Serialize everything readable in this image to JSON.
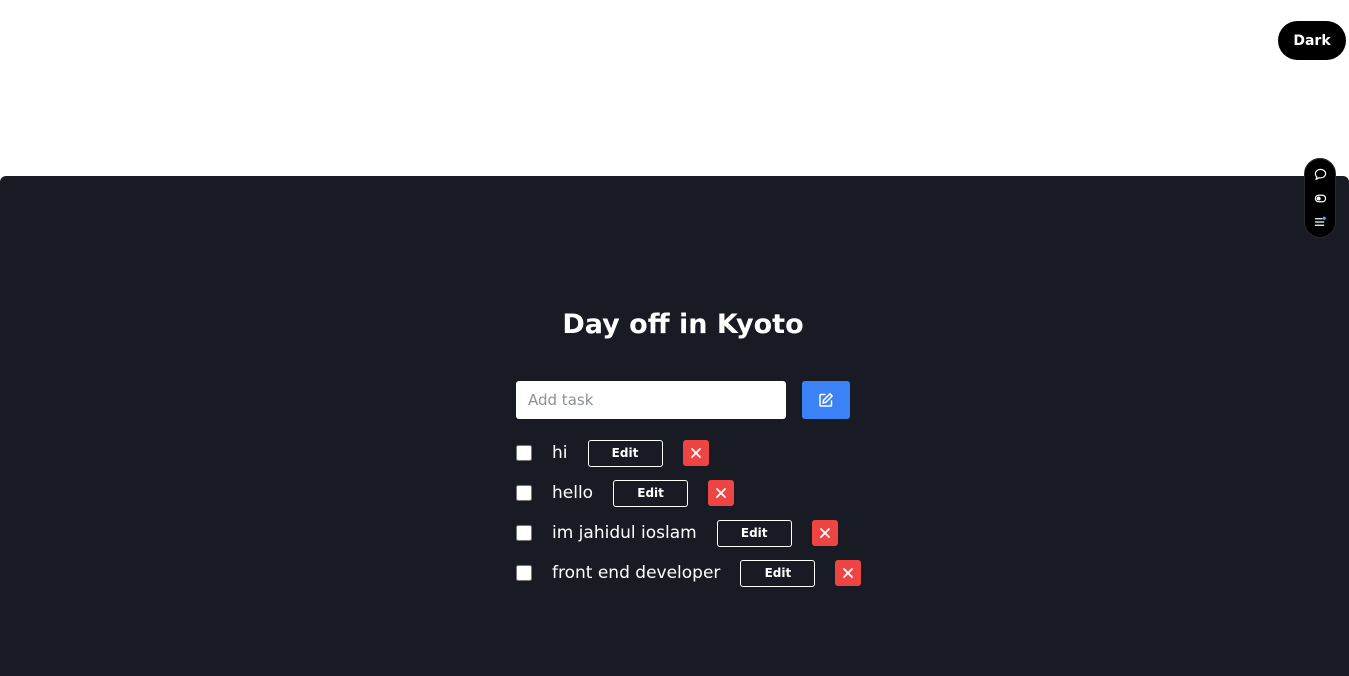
{
  "header": {
    "theme_toggle_label": "Dark"
  },
  "app": {
    "title": "Day off in Kyoto",
    "add_task": {
      "value": "",
      "placeholder": "Add task"
    },
    "edit_label": "Edit",
    "tasks": [
      {
        "text": "hi",
        "done": false
      },
      {
        "text": "hello",
        "done": false
      },
      {
        "text": "im jahidul ioslam",
        "done": false
      },
      {
        "text": "front end developer",
        "done": false
      }
    ]
  },
  "side_toolbar": {
    "tools": [
      "chat-bubble-icon",
      "toggle-eye-icon",
      "list-settings-icon"
    ]
  },
  "colors": {
    "panel_bg": "#191b24",
    "accent_blue": "#3b82f6",
    "danger_red": "#ef4444",
    "toggle_bg": "#000000"
  }
}
